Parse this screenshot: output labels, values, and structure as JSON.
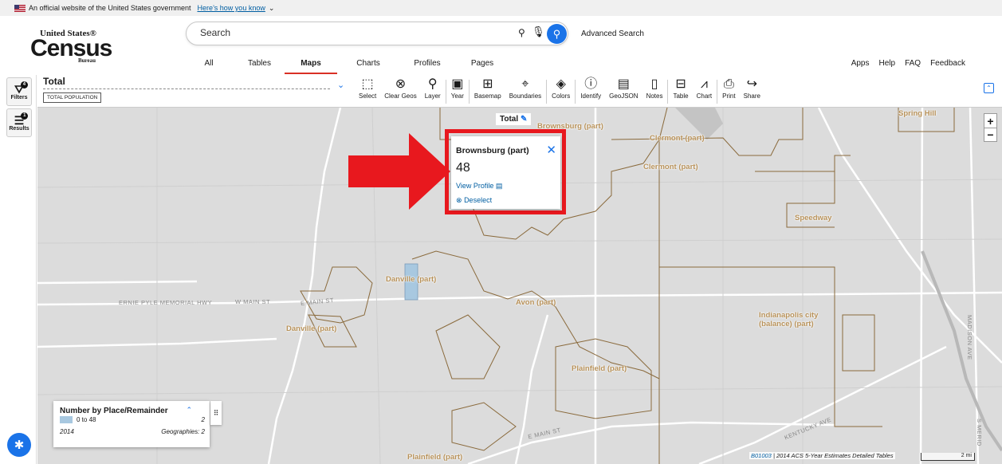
{
  "banner": {
    "text": "An official website of the United States government",
    "link": "Here’s how you know"
  },
  "logo": {
    "line1": "United States®",
    "line2": "Census",
    "line3": "Bureau"
  },
  "search": {
    "placeholder": "Search",
    "advanced": "Advanced Search"
  },
  "nav": {
    "tabs": [
      "All",
      "Tables",
      "Maps",
      "Charts",
      "Profiles",
      "Pages"
    ],
    "active": "Maps"
  },
  "links": [
    "Apps",
    "Help",
    "FAQ",
    "Feedback"
  ],
  "rail": {
    "filters_label": "Filters",
    "filters_count": "4",
    "results_label": "Results",
    "results_count": "1"
  },
  "toolbar": {
    "title": "Total",
    "chip": "TOTAL POPULATION",
    "tools": [
      "Select",
      "Clear Geos",
      "Layer",
      "Year",
      "Basemap",
      "Boundaries",
      "Colors",
      "Identify",
      "GeoJSON",
      "Notes",
      "Table",
      "Chart",
      "Print",
      "Share"
    ]
  },
  "map": {
    "total_tag": "Total",
    "places": [
      "Brownsburg (part)",
      "Clermont (part)",
      "Clermont (part)",
      "Speedway",
      "Danville (part)",
      "Avon (part)",
      "Danville (part)",
      "Indianapolis city (balance) (part)",
      "Plainfield (part)",
      "Plainfield (part)",
      "Spring Hill"
    ],
    "roads": [
      "ERNIE PYLE MEMORIAL HWY",
      "W MAIN ST",
      "E MAIN ST",
      "E MAIN ST",
      "KENTUCKY AVE",
      "MADISON AVE",
      "S MERID"
    ],
    "popup": {
      "title": "Brownsburg (part)",
      "value": "48",
      "view_profile": "View Profile",
      "deselect": "Deselect"
    }
  },
  "legend": {
    "title": "Number by Place/Remainder",
    "range": "0 to 48",
    "count": "2",
    "year": "2014",
    "geographies": "Geographies: 2",
    "swatch_color": "#a8c8e0"
  },
  "source": {
    "code": "B01003",
    "text": "2014 ACS 5-Year Estimates Detailed Tables",
    "scale": "2 mi"
  },
  "colors": {
    "accent": "#1a73e8",
    "highlight": "#e8181e",
    "boundary": "#8a6a3c"
  }
}
